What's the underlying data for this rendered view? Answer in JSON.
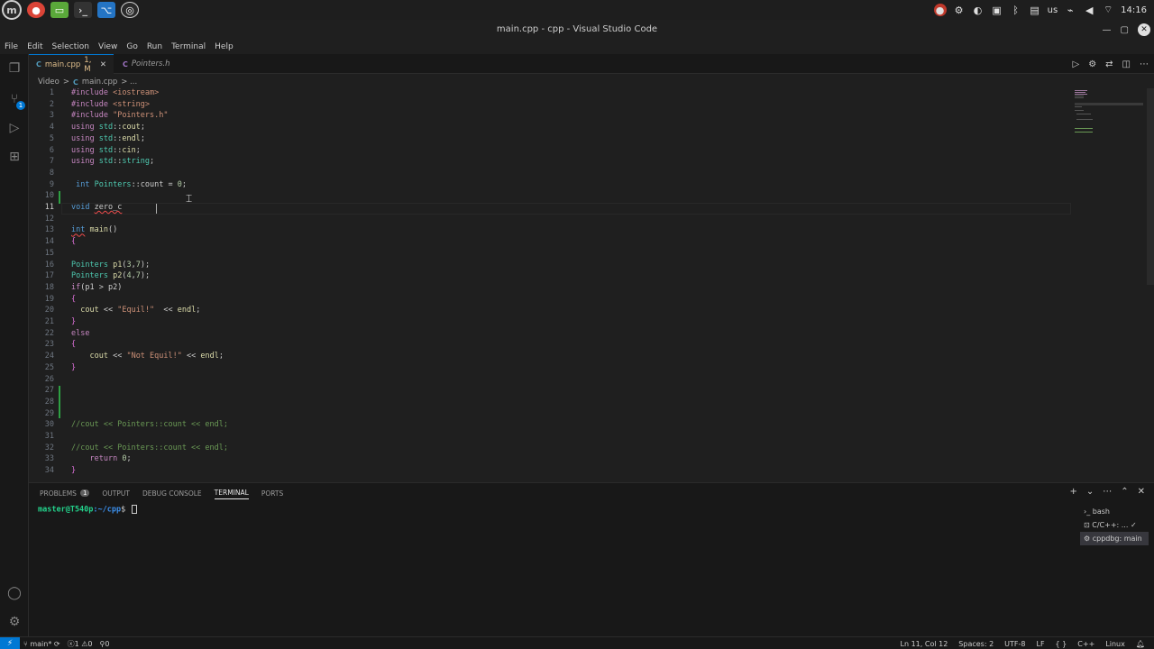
{
  "os": {
    "apps": [
      "menu-icon",
      "chrome-icon",
      "files-icon",
      "terminal-icon",
      "vscode-icon",
      "obs-icon"
    ],
    "tray": {
      "keyboard": "us",
      "clock": "14:16"
    }
  },
  "window": {
    "title": "main.cpp - cpp - Visual Studio Code"
  },
  "menu": [
    "File",
    "Edit",
    "Selection",
    "View",
    "Go",
    "Run",
    "Terminal",
    "Help"
  ],
  "activity": {
    "source_control_badge": "1"
  },
  "tabs": [
    {
      "icon": "C",
      "label": "main.cpp",
      "status": "1, M",
      "close": "✕"
    },
    {
      "icon": "C",
      "label": "Pointers.h"
    }
  ],
  "breadcrumb": {
    "folder": "Video",
    "sep": ">",
    "file": "main.cpp",
    "more": "> ..."
  },
  "editor": {
    "line_numbers": [
      "1",
      "2",
      "3",
      "4",
      "5",
      "6",
      "7",
      "8",
      "9",
      "10",
      "11",
      "12",
      "13",
      "14",
      "15",
      "16",
      "17",
      "18",
      "19",
      "20",
      "21",
      "22",
      "23",
      "24",
      "25",
      "26",
      "27",
      "28",
      "29",
      "30",
      "31",
      "32",
      "33",
      "34"
    ],
    "current_line": 11
  },
  "panel": {
    "tabs": [
      {
        "label": "PROBLEMS",
        "badge": "1"
      },
      {
        "label": "OUTPUT"
      },
      {
        "label": "DEBUG CONSOLE"
      },
      {
        "label": "TERMINAL",
        "active": true
      },
      {
        "label": "PORTS"
      }
    ],
    "terminal": {
      "user": "master@T540p",
      "path": ":~/cpp",
      "symbol": "$"
    },
    "terminals": [
      "bash",
      "C/C++: ...",
      "cppdbg: main"
    ]
  },
  "status": {
    "branch": "main*",
    "errors": "1",
    "warnings": "0",
    "ports": "0",
    "position": "Ln 11, Col 12",
    "spaces": "Spaces: 2",
    "encoding": "UTF-8",
    "eol": "LF",
    "braces": "{ }",
    "language": "C++",
    "platform": "Linux"
  },
  "colors": {
    "accent": "#0078d4",
    "modified": "#2ea043",
    "editor_bg": "#1f1f1f"
  }
}
